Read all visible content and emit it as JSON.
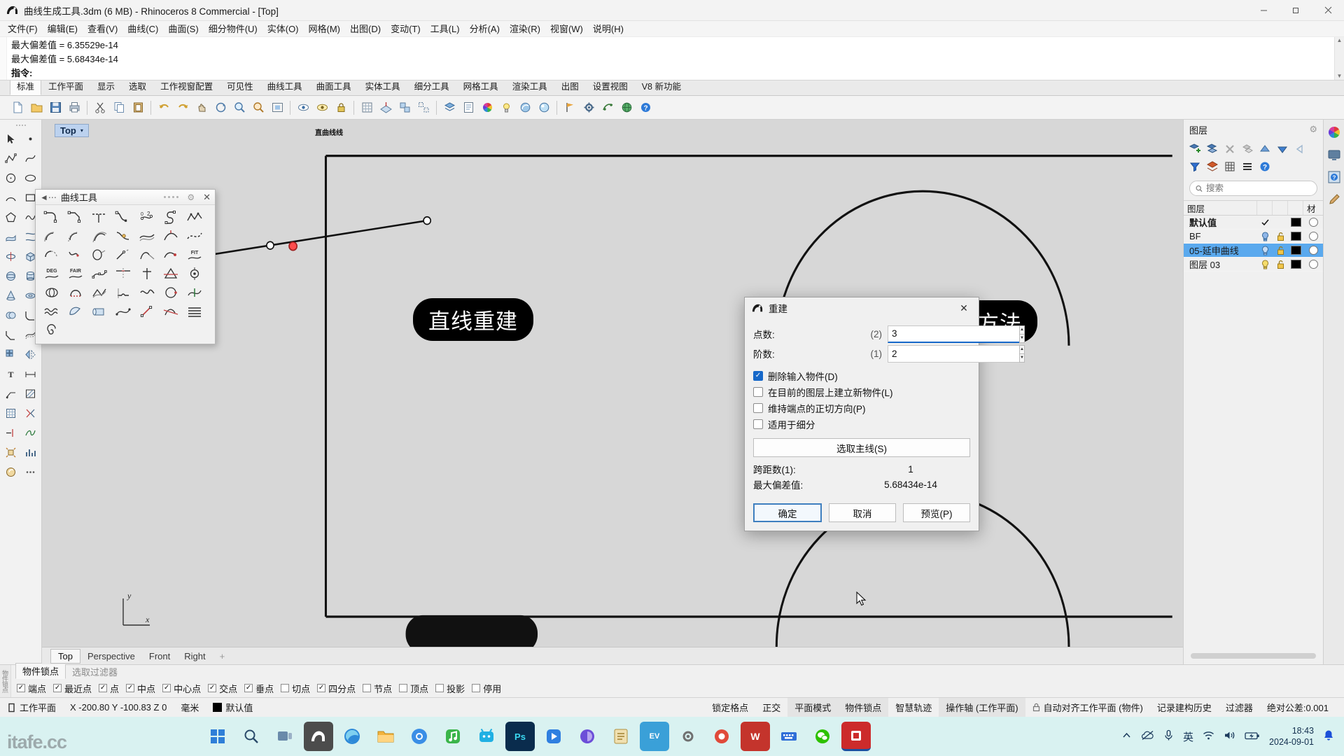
{
  "window": {
    "title": "曲线生成工具.3dm (6 MB) - Rhinoceros 8 Commercial - [Top]",
    "minimize": "—",
    "maximize": "❐",
    "close": "✕"
  },
  "menubar": {
    "items": [
      {
        "label": "文件(F)"
      },
      {
        "label": "编辑(E)"
      },
      {
        "label": "查看(V)"
      },
      {
        "label": "曲线(C)"
      },
      {
        "label": "曲面(S)"
      },
      {
        "label": "细分物件(U)"
      },
      {
        "label": "实体(O)"
      },
      {
        "label": "网格(M)"
      },
      {
        "label": "出图(D)"
      },
      {
        "label": "变动(T)"
      },
      {
        "label": "工具(L)"
      },
      {
        "label": "分析(A)"
      },
      {
        "label": "渲染(R)"
      },
      {
        "label": "视窗(W)"
      },
      {
        "label": "说明(H)"
      }
    ]
  },
  "command_area": {
    "history": [
      "最大偏差值 = 6.35529e-14",
      "最大偏差值 = 5.68434e-14"
    ],
    "prompt": "指令:",
    "input_value": ""
  },
  "toolbar_tabs": {
    "items": [
      {
        "label": "标准",
        "active": true
      },
      {
        "label": "工作平面",
        "active": false
      },
      {
        "label": "显示",
        "active": false
      },
      {
        "label": "选取",
        "active": false
      },
      {
        "label": "工作视窗配置",
        "active": false
      },
      {
        "label": "可见性",
        "active": false
      },
      {
        "label": "曲线工具",
        "active": false
      },
      {
        "label": "曲面工具",
        "active": false
      },
      {
        "label": "实体工具",
        "active": false
      },
      {
        "label": "细分工具",
        "active": false
      },
      {
        "label": "网格工具",
        "active": false
      },
      {
        "label": "渲染工具",
        "active": false
      },
      {
        "label": "出图",
        "active": false
      },
      {
        "label": "设置视图",
        "active": false
      },
      {
        "label": "V8 新功能",
        "active": false
      }
    ]
  },
  "icon_toolbar": {
    "buttons": [
      "new-file-icon",
      "open-folder-icon",
      "save-icon",
      "print-icon",
      "cut-icon",
      "copy-icon",
      "paste-icon",
      "undo-icon",
      "redo-icon",
      "pan-icon",
      "rotate-view-icon",
      "zoom-window-icon",
      "zoom-selected-icon",
      "zoom-extents-icon",
      "hide-objects-icon",
      "show-objects-icon",
      "lock-objects-icon",
      "grid-snap-icon",
      "planar-mode-icon",
      "group-icon",
      "ungroup-icon",
      "layers-icon",
      "object-properties-icon",
      "color-wheel-icon",
      "light-icon",
      "material-icon",
      "render-icon",
      "flag-icon",
      "gear-settings-icon",
      "grasshopper-icon",
      "globe-icon",
      "help-icon"
    ]
  },
  "left_toolbar": {
    "buttons": [
      "select-arrow-icon",
      "point-icon",
      "polyline-icon",
      "curve-icon",
      "circle-icon",
      "ellipse-icon",
      "arc-icon",
      "rectangle-icon",
      "polygon-icon",
      "freeform-curve-icon",
      "surface-icon",
      "loft-icon",
      "revolve-icon",
      "box-icon",
      "sphere-icon",
      "cylinder-icon",
      "cone-icon",
      "torus-icon",
      "boolean-union-icon",
      "fillet-icon",
      "chamfer-icon",
      "offset-icon",
      "array-icon",
      "mirror-icon",
      "text-icon",
      "dimension-icon",
      "leader-icon",
      "hatch-icon",
      "grid-icon",
      "split-icon",
      "trim-icon",
      "join-icon",
      "explode-icon",
      "analyze-icon",
      "render-preview-icon"
    ]
  },
  "viewport": {
    "name": "Top",
    "caret": "▾",
    "axis_y": "y",
    "axis_x": "x",
    "tiny_label": "直曲线线",
    "pill_left": "直线重建",
    "pill_right": "绘制方法",
    "tabs": [
      {
        "label": "Top",
        "active": true
      },
      {
        "label": "Perspective",
        "active": false
      },
      {
        "label": "Front",
        "active": false
      },
      {
        "label": "Right",
        "active": false
      }
    ],
    "add_tab": "+"
  },
  "layers_panel": {
    "title": "图层",
    "gear_icon": "gear-icon",
    "toolbar_icons": [
      "new-layer-icon",
      "new-sublayer-icon",
      "delete-layer-icon",
      "duplicate-layer-icon",
      "move-up-icon",
      "move-down-icon",
      "back-icon",
      "filter-icon",
      "layer-panel-icon",
      "grid-view-icon",
      "list-view-icon",
      "help-icon"
    ],
    "search_placeholder": "搜索",
    "search_value": "",
    "columns": [
      "图层",
      "",
      "",
      "",
      "材"
    ],
    "rows": [
      {
        "name": "默认值",
        "current": true,
        "bold": true,
        "light": "",
        "lock": "",
        "color": "#000000",
        "selected": false
      },
      {
        "name": "BF",
        "current": false,
        "bold": false,
        "light": "on",
        "lock": "unlocked",
        "color": "#000000",
        "selected": false
      },
      {
        "name": "05-延申曲线",
        "current": false,
        "bold": false,
        "light": "on",
        "lock": "unlocked",
        "color": "#000000",
        "selected": true
      },
      {
        "name": "图层 03",
        "current": false,
        "bold": false,
        "light": "on",
        "lock": "unlocked",
        "color": "#000000",
        "selected": false
      }
    ],
    "side_strip": [
      "color-wheel-icon",
      "display-icon",
      "help-circle-icon",
      "paint-brush-icon"
    ]
  },
  "curve_palette": {
    "back_icon": "back-arrow-icon",
    "title": "曲线工具",
    "gear_icon": "gear-icon",
    "close_icon": "close-icon",
    "buttons": [
      "fillet-curves-icon",
      "chamfer-curves-icon",
      "fillet-corners-icon",
      "blend-curves-icon",
      "adjustable-blend-icon",
      "arc-blend-icon",
      "curve-from-points-icon",
      "offset-curve-icon",
      "offset-loose-icon",
      "offset-multiple-icon",
      "variable-offset-icon",
      "offset-surface-icon",
      "offset-normal-icon",
      "dash-curve-icon",
      "extend-curve-icon",
      "extend-smooth-icon",
      "extend-arc-icon",
      "extend-line-icon",
      "extend-tangent-icon",
      "extend-point-icon",
      "fit-curve-icon",
      "degree-curve-icon",
      "fair-curve-icon",
      "rebuild-curve-icon",
      "match-curve-icon",
      "simplify-lines-icon",
      "cross-section-icon",
      "project-curve-icon",
      "curve-boolean-icon",
      "close-curve-icon",
      "convert-curve-icon",
      "make-periodic-icon",
      "smooth-curve-icon",
      "adjust-seam-icon",
      "insert-knot-icon",
      "wave-curve-icon",
      "curve-from-object-icon",
      "pipe-curve-icon",
      "curve-on-surface-icon",
      "curve-through-points-icon",
      "section-curve-icon",
      "contour-curve-icon",
      "spiral-curve-icon"
    ]
  },
  "rebuild_dialog": {
    "icon": "rhino-icon",
    "title": "重建",
    "close": "✕",
    "fields": [
      {
        "label": "点数:",
        "paren": "(2)",
        "value": "3",
        "focused": true
      },
      {
        "label": "阶数:",
        "paren": "(1)",
        "value": "2",
        "focused": false
      }
    ],
    "checkboxes": [
      {
        "label": "删除输入物件(D)",
        "checked": true
      },
      {
        "label": "在目前的图层上建立新物件(L)",
        "checked": false
      },
      {
        "label": "维持端点的正切方向(P)",
        "checked": false
      },
      {
        "label": "适用于细分",
        "checked": false
      }
    ],
    "select_master_button": "选取主线(S)",
    "info": [
      {
        "key": "跨距数(1):",
        "value": "1"
      },
      {
        "key": "最大偏差值:",
        "value": "5.68434e-14"
      }
    ],
    "buttons": [
      {
        "label": "确定",
        "default": true
      },
      {
        "label": "取消",
        "default": false
      },
      {
        "label": "预览(P)",
        "default": false
      }
    ]
  },
  "osnap_bar": {
    "side_label": "物件锁点",
    "tabs": [
      {
        "label": "物件锁点",
        "active": true
      },
      {
        "label": "选取过滤器",
        "active": false
      }
    ],
    "items": [
      {
        "label": "端点",
        "checked": true
      },
      {
        "label": "最近点",
        "checked": true
      },
      {
        "label": "点",
        "checked": true
      },
      {
        "label": "中点",
        "checked": true
      },
      {
        "label": "中心点",
        "checked": true
      },
      {
        "label": "交点",
        "checked": true
      },
      {
        "label": "垂点",
        "checked": true
      },
      {
        "label": "切点",
        "checked": false
      },
      {
        "label": "四分点",
        "checked": true
      },
      {
        "label": "节点",
        "checked": false
      },
      {
        "label": "顶点",
        "checked": false
      },
      {
        "label": "投影",
        "checked": false
      },
      {
        "label": "停用",
        "checked": false
      }
    ]
  },
  "status_bar": {
    "cplane_icon": "cplane-icon",
    "cplane_label": "工作平面",
    "coordinates": "X -200.80 Y -100.83 Z 0",
    "units": "毫米",
    "layer_swatch": "#000000",
    "layer_name": "默认值",
    "toggles": [
      {
        "label": "锁定格点",
        "active": false
      },
      {
        "label": "正交",
        "active": false
      },
      {
        "label": "平面模式",
        "active": true
      },
      {
        "label": "物件锁点",
        "active": true
      },
      {
        "label": "智慧轨迹",
        "active": false
      },
      {
        "label": "操作轴 (工作平面)",
        "active": true
      }
    ],
    "lock_icon": "lock-icon",
    "auto_cplane": "自动对齐工作平面 (物件)",
    "record_history": "记录建构历史",
    "filter": "过滤器",
    "tolerance": "绝对公差:0.001"
  },
  "taskbar": {
    "watermark": "itafe.cc",
    "start_icon": "windows-start-icon",
    "search_icon": "search-icon",
    "taskview_icon": "task-view-icon",
    "apps": [
      {
        "name": "rhino-icon",
        "color": "#4c4c4c",
        "glyph": "R"
      },
      {
        "name": "edge-browser-icon",
        "color": "#2e8ad8",
        "glyph": "e"
      },
      {
        "name": "file-explorer-icon",
        "color": "#f2b33d",
        "glyph": "▤"
      },
      {
        "name": "chrome-browser-icon",
        "color": "#3a8ee6",
        "glyph": "◉"
      },
      {
        "name": "qq-music-icon",
        "color": "#3ab54a",
        "glyph": "♪"
      },
      {
        "name": "bilibili-icon",
        "color": "#20b0e3",
        "glyph": "▷"
      },
      {
        "name": "photoshop-icon",
        "color": "#0a2c4d",
        "glyph": "Ps"
      },
      {
        "name": "video-player-icon",
        "color": "#2f7fe0",
        "glyph": "▶"
      },
      {
        "name": "chat-app-icon",
        "color": "#6c4ed8",
        "glyph": "◐"
      },
      {
        "name": "notes-icon",
        "color": "#d8a13a",
        "glyph": "✎"
      },
      {
        "name": "ev-recorder-icon",
        "color": "#3aa0d8",
        "glyph": "EV"
      },
      {
        "name": "settings-app-icon",
        "color": "#888888",
        "glyph": "⚙"
      },
      {
        "name": "screenshot-icon",
        "color": "#e04a3a",
        "glyph": "◎"
      },
      {
        "name": "wps-writer-icon",
        "color": "#c4342c",
        "glyph": "W"
      },
      {
        "name": "keyboard-icon",
        "color": "#2f6fd8",
        "glyph": "⌨"
      },
      {
        "name": "wechat-icon",
        "color": "#2dc100",
        "glyph": "✆"
      },
      {
        "name": "active-app-icon",
        "color": "#cc2b2b",
        "glyph": "◼"
      }
    ],
    "tray": {
      "chevron_icon": "chevron-up-icon",
      "cloud_off_icon": "cloud-off-icon",
      "mic_icon": "microphone-icon",
      "ime_label": "英",
      "wifi_icon": "wifi-icon",
      "volume_icon": "volume-icon",
      "battery_icon": "battery-charging-icon",
      "time": "18:43",
      "date": "2024-09-01",
      "notification_icon": "bell-icon"
    }
  }
}
